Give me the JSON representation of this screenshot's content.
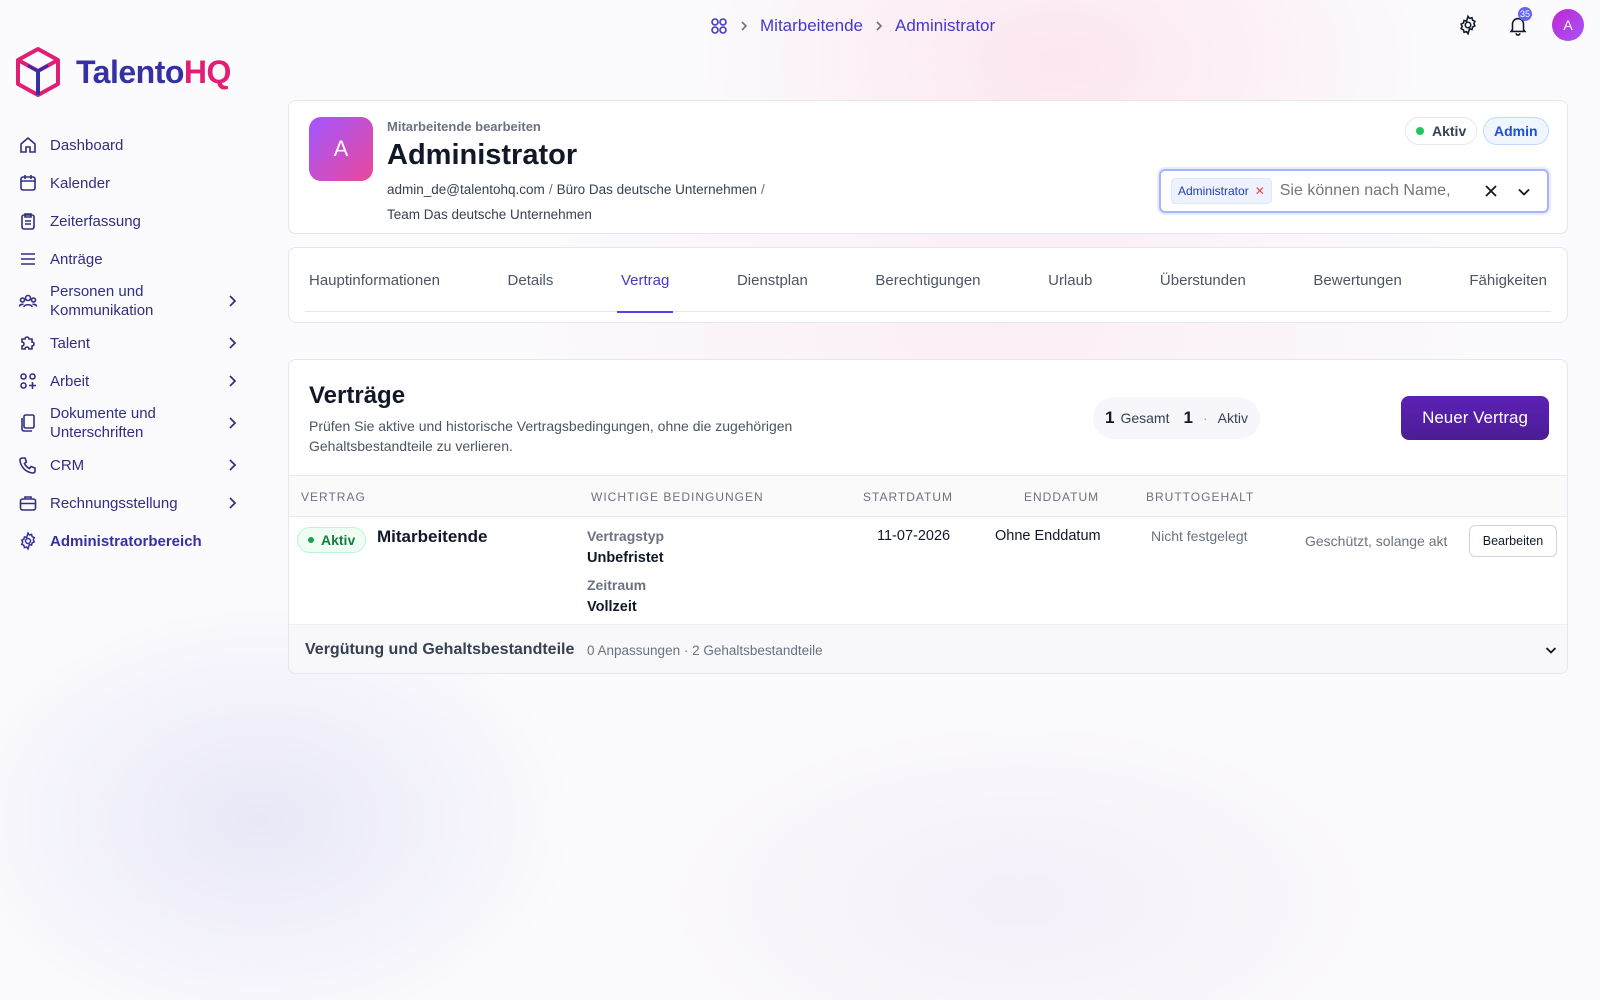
{
  "breadcrumb": {
    "items": [
      "Mitarbeitende",
      "Administrator"
    ]
  },
  "topbar": {
    "notification_count": "35",
    "avatar_initial": "A"
  },
  "logo": {
    "part1": "Talento",
    "part2": "HQ"
  },
  "sidebar": {
    "items": [
      {
        "label": "Dashboard",
        "icon": "home-icon"
      },
      {
        "label": "Kalender",
        "icon": "calendar-icon"
      },
      {
        "label": "Zeiterfassung",
        "icon": "clipboard-icon"
      },
      {
        "label": "Anträge",
        "icon": "list-icon"
      },
      {
        "label": "Personen und Kommunikation",
        "icon": "users-icon"
      },
      {
        "label": "Talent",
        "icon": "puzzle-icon"
      },
      {
        "label": "Arbeit",
        "icon": "grid-plus-icon"
      },
      {
        "label": "Dokumente und Unterschriften",
        "icon": "documents-icon"
      },
      {
        "label": "CRM",
        "icon": "phone-icon"
      },
      {
        "label": "Rechnungsstellung",
        "icon": "briefcase-icon"
      },
      {
        "label": "Administratorbereich",
        "icon": "gear-icon"
      }
    ]
  },
  "profile": {
    "avatar_initial": "A",
    "subtitle": "Mitarbeitende bearbeiten",
    "name": "Administrator",
    "email": "admin_de@talentohq.com",
    "office": "Büro Das deutsche Unternehmen",
    "team": "Team Das deutsche Unternehmen",
    "status": "Aktiv",
    "role_badge": "Admin",
    "colors": {
      "status": "#22c55e",
      "role": "#1d4ed8"
    }
  },
  "selector": {
    "tag": "Administrator",
    "placeholder": "Sie können nach Name,"
  },
  "tabs": [
    {
      "label": "Hauptinformationen"
    },
    {
      "label": "Details"
    },
    {
      "label": "Vertrag",
      "active": true
    },
    {
      "label": "Dienstplan"
    },
    {
      "label": "Berechtigungen"
    },
    {
      "label": "Urlaub"
    },
    {
      "label": "Überstunden"
    },
    {
      "label": "Bewertungen"
    },
    {
      "label": "Fähigkeiten"
    }
  ],
  "contracts": {
    "title": "Verträge",
    "description": "Prüfen Sie aktive und historische Vertragsbedingungen, ohne die zugehörigen Gehaltsbestandteile zu verlieren.",
    "stats": {
      "total_count": "1",
      "total_label": "Gesamt",
      "active_count": "1",
      "sep": "·",
      "active_label": "Aktiv"
    },
    "new_button": "Neuer Vertrag",
    "columns": [
      "VERTRAG",
      "WICHTIGE BEDINGUNGEN",
      "STARTDATUM",
      "ENDDATUM",
      "BRUTTOGEHALT"
    ],
    "rows": [
      {
        "status": "Aktiv",
        "role": "Mitarbeitende",
        "type_label": "Vertragstyp",
        "type_value": "Unbefristet",
        "period_label": "Zeitraum",
        "period_value": "Vollzeit",
        "start": "11-07-2026",
        "end": "Ohne Enddatum",
        "salary": "Nicht festgelegt",
        "protection": "Geschützt, solange akt",
        "edit_label": "Bearbeiten"
      }
    ],
    "compensation": {
      "title": "Vergütung und Gehaltsbestandteile",
      "summary": "0 Anpassungen · 2 Gehaltsbestandteile"
    }
  },
  "colors": {
    "accent": "#4338ca",
    "brand_primary": "#3730a3",
    "brand_secondary": "#e11d74",
    "button": "#4c1d95"
  }
}
